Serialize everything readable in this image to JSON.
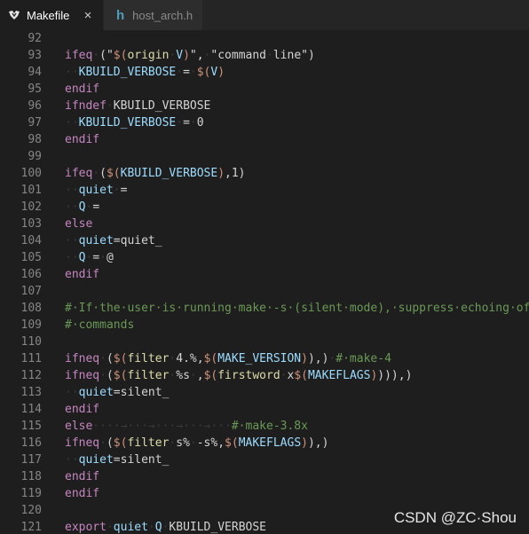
{
  "tabs": [
    {
      "label": "Makefile",
      "active": true,
      "icon": "makefile-icon",
      "close": "×"
    },
    {
      "label": "host_arch.h",
      "active": false,
      "icon": "h-file-icon",
      "icon_text": "h"
    }
  ],
  "colors": {
    "keyword": "#c586c0",
    "function": "#dcdcaa",
    "variable": "#9cdcfe",
    "string": "#ce9178",
    "comment": "#6a9955",
    "whitespace": "#3b3b3b",
    "plain": "#d4d4d4",
    "line_number": "#858585"
  },
  "lines": [
    {
      "n": "92",
      "t": [
        [
          "",
          "pl"
        ]
      ]
    },
    {
      "n": "93",
      "t": [
        [
          "ifeq",
          "kw"
        ],
        [
          "·",
          "ws"
        ],
        [
          "(\"",
          "pl"
        ],
        [
          "$(",
          "str"
        ],
        [
          "origin",
          "fn"
        ],
        [
          "·",
          "ws"
        ],
        [
          "V",
          "var"
        ],
        [
          ")",
          "str"
        ],
        [
          "\",",
          "pl"
        ],
        [
          "·",
          "ws"
        ],
        [
          "\"command",
          "pl"
        ],
        [
          "·",
          "ws"
        ],
        [
          "line\")",
          "pl"
        ]
      ]
    },
    {
      "n": "94",
      "t": [
        [
          "··",
          "ws"
        ],
        [
          "KBUILD_VERBOSE",
          "var"
        ],
        [
          "·",
          "ws"
        ],
        [
          "=",
          "pl"
        ],
        [
          "·",
          "ws"
        ],
        [
          "$(",
          "str"
        ],
        [
          "V",
          "var"
        ],
        [
          ")",
          "str"
        ]
      ]
    },
    {
      "n": "95",
      "t": [
        [
          "endif",
          "kw"
        ]
      ]
    },
    {
      "n": "96",
      "t": [
        [
          "ifndef",
          "kw"
        ],
        [
          "·",
          "ws"
        ],
        [
          "KBUILD_VERBOSE",
          "pl"
        ]
      ]
    },
    {
      "n": "97",
      "t": [
        [
          "··",
          "ws"
        ],
        [
          "KBUILD_VERBOSE",
          "var"
        ],
        [
          "·",
          "ws"
        ],
        [
          "=",
          "pl"
        ],
        [
          "·",
          "ws"
        ],
        [
          "0",
          "pl"
        ]
      ]
    },
    {
      "n": "98",
      "t": [
        [
          "endif",
          "kw"
        ]
      ]
    },
    {
      "n": "99",
      "t": [
        [
          "",
          "pl"
        ]
      ]
    },
    {
      "n": "100",
      "t": [
        [
          "ifeq",
          "kw"
        ],
        [
          "·",
          "ws"
        ],
        [
          "(",
          "pl"
        ],
        [
          "$(",
          "str"
        ],
        [
          "KBUILD_VERBOSE",
          "var"
        ],
        [
          ")",
          "str"
        ],
        [
          ",1)",
          "pl"
        ]
      ]
    },
    {
      "n": "101",
      "t": [
        [
          "··",
          "ws"
        ],
        [
          "quiet",
          "var"
        ],
        [
          "·",
          "ws"
        ],
        [
          "=",
          "pl"
        ]
      ]
    },
    {
      "n": "102",
      "t": [
        [
          "··",
          "ws"
        ],
        [
          "Q",
          "var"
        ],
        [
          "·",
          "ws"
        ],
        [
          "=",
          "pl"
        ]
      ]
    },
    {
      "n": "103",
      "t": [
        [
          "else",
          "kw"
        ]
      ]
    },
    {
      "n": "104",
      "t": [
        [
          "··",
          "ws"
        ],
        [
          "quiet",
          "var"
        ],
        [
          "=quiet_",
          "pl"
        ]
      ]
    },
    {
      "n": "105",
      "t": [
        [
          "··",
          "ws"
        ],
        [
          "Q",
          "var"
        ],
        [
          "·",
          "ws"
        ],
        [
          "=",
          "pl"
        ],
        [
          "·",
          "ws"
        ],
        [
          "@",
          "pl"
        ]
      ]
    },
    {
      "n": "106",
      "t": [
        [
          "endif",
          "kw"
        ]
      ]
    },
    {
      "n": "107",
      "t": [
        [
          "",
          "pl"
        ]
      ]
    },
    {
      "n": "108",
      "t": [
        [
          "#·If·the·user·is·running·make·-s·(silent·mode),·suppress·echoing·of",
          "cm"
        ]
      ]
    },
    {
      "n": "109",
      "t": [
        [
          "#·commands",
          "cm"
        ]
      ]
    },
    {
      "n": "110",
      "t": [
        [
          "",
          "pl"
        ]
      ]
    },
    {
      "n": "111",
      "t": [
        [
          "ifneq",
          "kw"
        ],
        [
          "·",
          "ws"
        ],
        [
          "(",
          "pl"
        ],
        [
          "$(",
          "str"
        ],
        [
          "filter",
          "fn"
        ],
        [
          "·",
          "ws"
        ],
        [
          "4.%",
          "pl"
        ],
        [
          ",",
          "pl"
        ],
        [
          "$(",
          "str"
        ],
        [
          "MAKE_VERSION",
          "var"
        ],
        [
          ")",
          "str"
        ],
        [
          "),)",
          "pl"
        ],
        [
          "·",
          "ws"
        ],
        [
          "#·make-4",
          "cm"
        ]
      ]
    },
    {
      "n": "112",
      "t": [
        [
          "ifneq",
          "kw"
        ],
        [
          "·",
          "ws"
        ],
        [
          "(",
          "pl"
        ],
        [
          "$(",
          "str"
        ],
        [
          "filter",
          "fn"
        ],
        [
          "·",
          "ws"
        ],
        [
          "%s",
          "pl"
        ],
        [
          "·",
          "ws"
        ],
        [
          ",",
          "pl"
        ],
        [
          "$(",
          "str"
        ],
        [
          "firstword",
          "fn"
        ],
        [
          "·",
          "ws"
        ],
        [
          "x",
          "pl"
        ],
        [
          "$(",
          "str"
        ],
        [
          "MAKEFLAGS",
          "var"
        ],
        [
          ")",
          "str"
        ],
        [
          "))),)",
          "pl"
        ]
      ]
    },
    {
      "n": "113",
      "t": [
        [
          "··",
          "ws"
        ],
        [
          "quiet",
          "var"
        ],
        [
          "=silent_",
          "pl"
        ]
      ]
    },
    {
      "n": "114",
      "t": [
        [
          "endif",
          "kw"
        ]
      ]
    },
    {
      "n": "115",
      "t": [
        [
          "else",
          "kw"
        ],
        [
          "····→···→···→···→···",
          "ws"
        ],
        [
          "#·make-3.8x",
          "cm"
        ]
      ]
    },
    {
      "n": "116",
      "t": [
        [
          "ifneq",
          "kw"
        ],
        [
          "·",
          "ws"
        ],
        [
          "(",
          "pl"
        ],
        [
          "$(",
          "str"
        ],
        [
          "filter",
          "fn"
        ],
        [
          "·",
          "ws"
        ],
        [
          "s%",
          "pl"
        ],
        [
          "·",
          "ws"
        ],
        [
          "-s%",
          "pl"
        ],
        [
          ",",
          "pl"
        ],
        [
          "$(",
          "str"
        ],
        [
          "MAKEFLAGS",
          "var"
        ],
        [
          ")",
          "str"
        ],
        [
          "),)",
          "pl"
        ]
      ]
    },
    {
      "n": "117",
      "t": [
        [
          "··",
          "ws"
        ],
        [
          "quiet",
          "var"
        ],
        [
          "=silent_",
          "pl"
        ]
      ]
    },
    {
      "n": "118",
      "t": [
        [
          "endif",
          "kw"
        ]
      ]
    },
    {
      "n": "119",
      "t": [
        [
          "endif",
          "kw"
        ]
      ]
    },
    {
      "n": "120",
      "t": [
        [
          "",
          "pl"
        ]
      ]
    },
    {
      "n": "121",
      "t": [
        [
          "export",
          "kw"
        ],
        [
          "·",
          "ws"
        ],
        [
          "quiet",
          "var"
        ],
        [
          "·",
          "ws"
        ],
        [
          "Q",
          "var"
        ],
        [
          "·",
          "ws"
        ],
        [
          "KBUILD_VERBOSE",
          "pl"
        ]
      ]
    }
  ],
  "watermark": "CSDN @ZC·Shou"
}
